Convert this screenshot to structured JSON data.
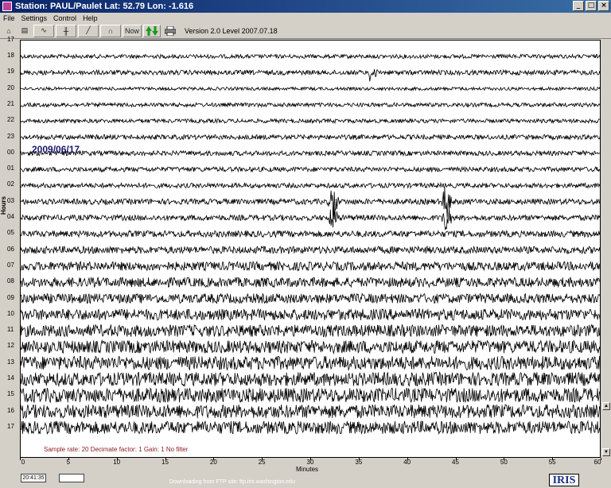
{
  "window": {
    "title": "Station: PAUL/Paulet Lat: 52.79 Lon: -1.616",
    "minimize_glyph": "_",
    "maximize_glyph": "□",
    "close_glyph": "×"
  },
  "menu": [
    "File",
    "Settings",
    "Control",
    "Help"
  ],
  "toolbar": {
    "buttons": [
      {
        "name": "open-icon",
        "glyph": "⌂"
      },
      {
        "name": "save-icon",
        "glyph": "▤"
      },
      {
        "name": "trace-icon",
        "glyph": "∿"
      },
      {
        "name": "cursor-icon",
        "glyph": "╫"
      },
      {
        "name": "zoom-icon",
        "glyph": "╱"
      },
      {
        "name": "filter-icon",
        "glyph": "∩"
      }
    ],
    "now_label": "Now",
    "arrows_icon": "arrows-up-down-icon",
    "print_icon": "printer-icon",
    "version": "Version 2.0 Level 2007.07.18"
  },
  "plot": {
    "date_annotation": "2009/06/17",
    "ylabel": "Hours",
    "xlabel": "Minutes",
    "info_line": "Sample rate: 20   Decimate factor: 1   Gain: 1   No filter"
  },
  "chart_data": {
    "type": "line",
    "title": "",
    "xlabel": "Minutes",
    "ylabel": "Hours",
    "xlim": [
      0,
      60
    ],
    "x_ticks": [
      0,
      5,
      10,
      15,
      20,
      25,
      30,
      35,
      40,
      45,
      50,
      55,
      60
    ],
    "hour_rows": [
      "18",
      "19",
      "20",
      "21",
      "22",
      "23",
      "00",
      "01",
      "02",
      "03",
      "04",
      "05",
      "06",
      "07",
      "08",
      "09",
      "10",
      "11",
      "12",
      "13",
      "14",
      "15",
      "16",
      "17"
    ],
    "top_partial_label": "17",
    "trace_color": "#000000",
    "noise_amplitude": [
      0.25,
      0.3,
      0.2,
      0.25,
      0.25,
      0.3,
      0.3,
      0.3,
      0.3,
      0.35,
      0.35,
      0.4,
      0.45,
      0.55,
      0.6,
      0.6,
      0.7,
      0.75,
      0.8,
      0.85,
      0.85,
      0.9,
      0.85,
      0.8
    ],
    "events": [
      {
        "hour": "19",
        "minute": 36.3,
        "amplitude": 1.4
      },
      {
        "hour": "03",
        "minute": 32.3,
        "amplitude": 2.5
      },
      {
        "hour": "03",
        "minute": 44.0,
        "amplitude": 2.5
      },
      {
        "hour": "04",
        "minute": 32.3,
        "amplitude": 2.2
      },
      {
        "hour": "04",
        "minute": 44.0,
        "amplitude": 2.2
      }
    ]
  },
  "status": {
    "time": "20:41:35",
    "message": "Downloading from FTP site: ftp.iris.washington.edu",
    "logo": "IRIS"
  }
}
